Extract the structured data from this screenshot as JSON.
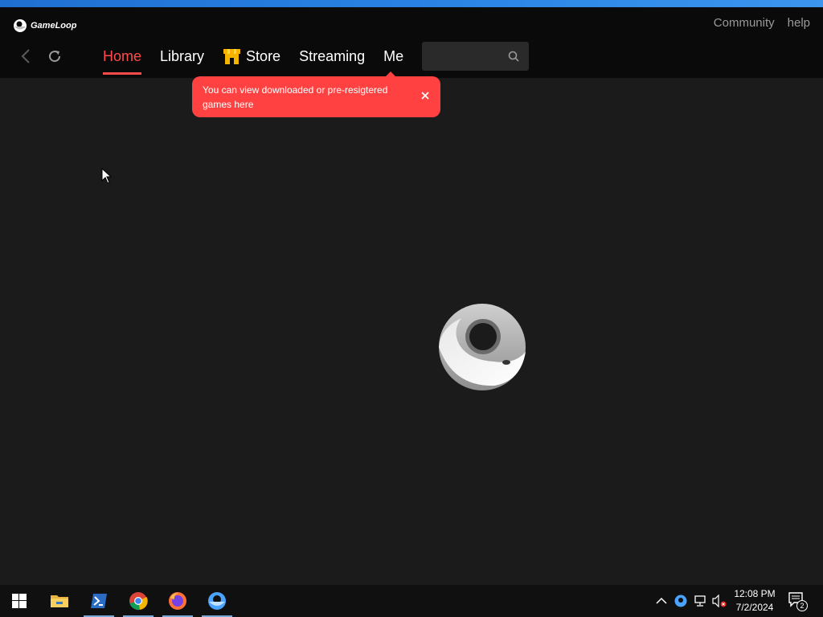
{
  "app": {
    "logo_text": "GameLoop",
    "top_links": {
      "community": "Community",
      "help": "help"
    },
    "tabs": [
      {
        "label": "Home",
        "active": true
      },
      {
        "label": "Library",
        "active": false
      },
      {
        "label": "Store",
        "active": false,
        "icon": "store-icon"
      },
      {
        "label": "Streaming",
        "active": false
      },
      {
        "label": "Me",
        "active": false
      }
    ],
    "search": {
      "placeholder": "",
      "value": ""
    },
    "tooltip": {
      "text": "You can view downloaded or pre-resigtered games here"
    }
  },
  "colors": {
    "accent": "#ff4b4b",
    "tooltip_bg": "#ff4141",
    "header_bg": "#0a0a0a",
    "content_bg": "#1b1b1b"
  },
  "taskbar": {
    "pinned": [
      "windows-start-icon",
      "file-explorer-icon",
      "powershell-icon",
      "chrome-icon",
      "firefox-icon",
      "gameloop-icon"
    ],
    "tray": [
      "chevron-up-icon",
      "gameloop-tray-icon",
      "network-icon",
      "volume-muted-icon"
    ],
    "time": "12:08 PM",
    "date": "7/2/2024",
    "notification_count": "2"
  }
}
